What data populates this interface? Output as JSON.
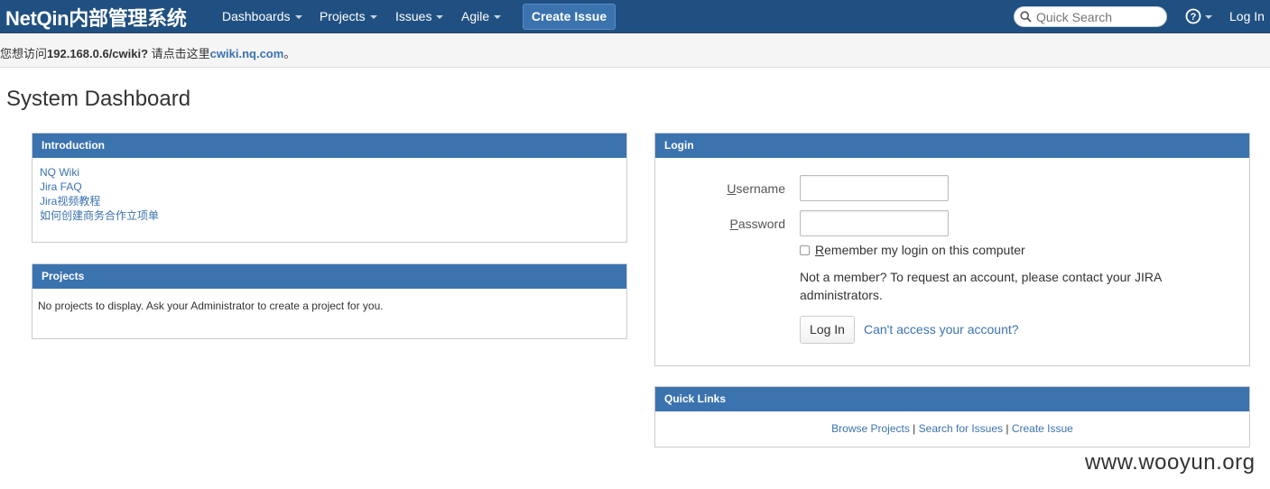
{
  "header": {
    "logo": "NetQin内部管理系统",
    "nav": [
      {
        "label": "Dashboards"
      },
      {
        "label": "Projects"
      },
      {
        "label": "Issues"
      },
      {
        "label": "Agile"
      }
    ],
    "create_issue": "Create Issue",
    "search_placeholder": "Quick Search",
    "login": "Log In"
  },
  "notice": {
    "prefix": "您想访问",
    "address": "192.168.0.6/cwiki?",
    "middle": " 请点击这里",
    "link": "cwiki.nq.com",
    "suffix": "。"
  },
  "page_title": "System Dashboard",
  "introduction": {
    "title": "Introduction",
    "links": [
      "NQ Wiki",
      "Jira FAQ",
      "Jira视频教程",
      "如何创建商务合作立项单"
    ]
  },
  "projects": {
    "title": "Projects",
    "message": "No projects to display. Ask your Administrator to create a project for you."
  },
  "login": {
    "title": "Login",
    "username_first": "U",
    "username_rest": "sername",
    "password_first": "P",
    "password_rest": "assword",
    "remember_first": "R",
    "remember_rest": "emember my login on this computer",
    "not_member": "Not a member? To request an account, please contact your JIRA administrators.",
    "login_button": "Log In",
    "cant_access": "Can't access your account?"
  },
  "quick_links": {
    "title": "Quick Links",
    "browse": "Browse Projects",
    "search": "Search for Issues",
    "create": "Create Issue",
    "separator": " | "
  },
  "watermark": "www.wooyun.org"
}
